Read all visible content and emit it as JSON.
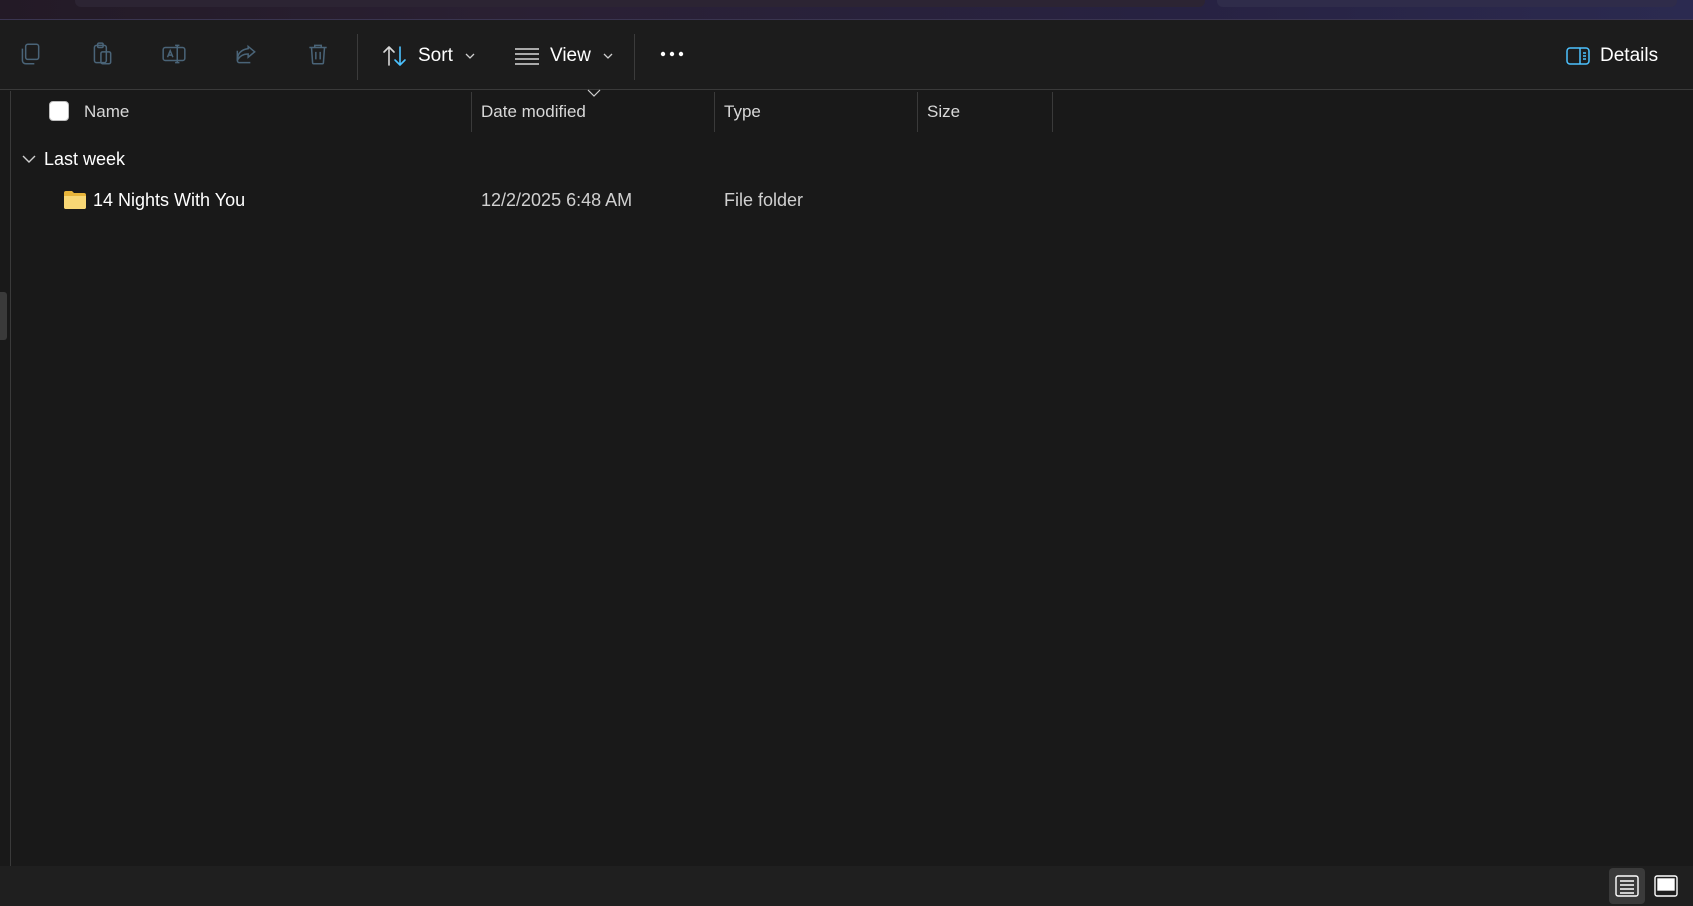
{
  "toolbar": {
    "icons": [
      "copy-icon",
      "paste-icon",
      "rename-icon",
      "share-icon",
      "delete-icon"
    ],
    "sort_label": "Sort",
    "view_label": "View",
    "more_icon": "more-icon",
    "details_label": "Details",
    "accent": "#4cc2ff"
  },
  "columns": {
    "name": "Name",
    "date_modified": "Date modified",
    "type": "Type",
    "size": "Size"
  },
  "groups": [
    {
      "label": "Last week",
      "items": [
        {
          "name": "14 Nights With You",
          "date_modified": "12/2/2025 6:48 AM",
          "type": "File folder",
          "size": "",
          "icon": "folder-icon"
        }
      ]
    }
  ],
  "statusbar": {
    "views": [
      "details-view-icon",
      "tiles-view-icon"
    ],
    "active_view": "details-view-icon"
  },
  "colors": {
    "background": "#191919",
    "folder": "#f8d775"
  }
}
